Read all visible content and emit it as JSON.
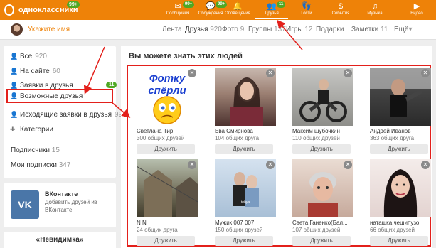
{
  "topbar": {
    "brand": "одноклассники",
    "brand_badge": "99+",
    "nav": [
      {
        "label": "Сообщения",
        "glyph": "✉",
        "badge": "99+",
        "icon": "envelope-icon"
      },
      {
        "label": "Обсуждения",
        "glyph": "💬",
        "badge": "99+",
        "icon": "chat-bubble-icon"
      },
      {
        "label": "Оповещения",
        "glyph": "🔔",
        "badge": "",
        "icon": "bell-icon"
      },
      {
        "label": "Друзья",
        "glyph": "👥",
        "badge": "11",
        "icon": "friends-icon"
      },
      {
        "label": "Гости",
        "glyph": "👣",
        "badge": "",
        "icon": "footsteps-icon"
      },
      {
        "label": "События",
        "glyph": "$",
        "badge": "",
        "icon": "events-icon"
      },
      {
        "label": "Музыка",
        "glyph": "♫",
        "badge": "",
        "icon": "music-icon"
      },
      {
        "label": "Видео",
        "glyph": "▶",
        "badge": "",
        "icon": "video-icon"
      }
    ]
  },
  "profile": {
    "name_placeholder": "Укажите имя",
    "tabs": [
      {
        "label": "Лента",
        "count": ""
      },
      {
        "label": "Друзья",
        "count": "920"
      },
      {
        "label": "Фото",
        "count": "9"
      },
      {
        "label": "Группы",
        "count": "137"
      },
      {
        "label": "Игры",
        "count": "12"
      },
      {
        "label": "Подарки",
        "count": ""
      },
      {
        "label": "Заметки",
        "count": "11"
      },
      {
        "label": "Ещё",
        "count": "▾"
      }
    ]
  },
  "sidebar": {
    "items": [
      {
        "label": "Все",
        "count": "920",
        "icon": "people-icon"
      },
      {
        "label": "На сайте",
        "count": "60",
        "icon": "online-icon"
      },
      {
        "label": "Заявки в друзья",
        "count": "",
        "icon": "add-person-icon",
        "badge": "11"
      },
      {
        "label": "Возможные друзья",
        "count": "",
        "icon": "possible-friends-icon"
      },
      {
        "label": "Исходящие заявки в друзья",
        "count": "99+",
        "icon": "outgoing-request-icon"
      },
      {
        "label": "Категории",
        "count": "",
        "icon": "categories-icon"
      }
    ],
    "subscribers": {
      "label": "Подписчики",
      "count": "15"
    },
    "subscriptions": {
      "label": "Мои подписки",
      "count": "347"
    }
  },
  "vk": {
    "logo": "VK",
    "title": "ВКонтакте",
    "desc": "Добавить друзей из ВКонтакте"
  },
  "invisible": {
    "title": "«Невидимка»"
  },
  "main": {
    "title": "Вы можете знать этих людей",
    "cards": [
      {
        "name": "Светлана Тир",
        "mutual": "300 общих друзей",
        "button": "Дружить",
        "photo_text": "Фотку спёрли"
      },
      {
        "name": "Ева Смирнова",
        "mutual": "104 общих друга",
        "button": "Дружить"
      },
      {
        "name": "Максим шубочкин",
        "mutual": "110 общих друзей",
        "button": "Дружить"
      },
      {
        "name": "Андрей Иванов",
        "mutual": "363 общих друга",
        "button": "Дружить"
      },
      {
        "name": "N N",
        "mutual": "24 общих друга",
        "button": "Дружить"
      },
      {
        "name": "Мужик 007 007",
        "mutual": "150 общих друзей",
        "button": "Дружить"
      },
      {
        "name": "Света Ганенко(Бал...",
        "mutual": "107 общих друзей",
        "button": "Дружить"
      },
      {
        "name": "наташка чешипузо",
        "mutual": "66 общих друзей",
        "button": "Дружить"
      }
    ]
  },
  "colors": {
    "accent": "#ee8208",
    "badge": "#4fa823",
    "highlight": "#e3201b"
  }
}
